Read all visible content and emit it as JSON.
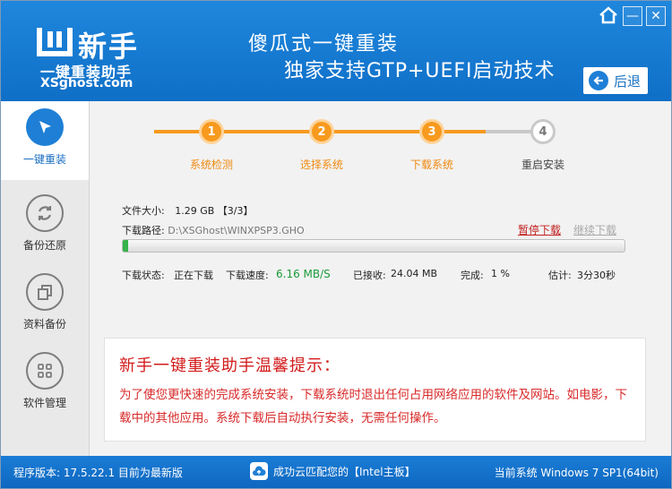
{
  "header": {
    "logo_cn": "新手",
    "logo_sub": "一键重装助手",
    "logo_site": "XSghost.com",
    "slogan_line1": "傻瓜式一键重装",
    "slogan_line2": "独家支持GTP+UEFI启动技术",
    "back_label": "后退",
    "controls": [
      "home-icon",
      "minimize-icon",
      "close-icon"
    ]
  },
  "sidebar": {
    "items": [
      {
        "label": "一键重装",
        "icon": "cursor-arrow-icon",
        "active": true
      },
      {
        "label": "备份还原",
        "icon": "sync-icon",
        "active": false
      },
      {
        "label": "资料备份",
        "icon": "copy-icon",
        "active": false
      },
      {
        "label": "软件管理",
        "icon": "grid-icon",
        "active": false
      }
    ]
  },
  "steps": [
    {
      "num": "1",
      "label": "系统检测",
      "done": true
    },
    {
      "num": "2",
      "label": "选择系统",
      "done": true
    },
    {
      "num": "3",
      "label": "下载系统",
      "done": true
    },
    {
      "num": "4",
      "label": "重启安装",
      "done": false
    }
  ],
  "download": {
    "file_size_label": "文件大小:",
    "file_size_value": "1.29 GB 【3/3】",
    "path_label": "下载路径:",
    "path_value": "D:\\XSGhost\\WINXPSP3.GHO",
    "pause_label": "暂停下载",
    "resume_label": "继续下载",
    "progress_percent": 1,
    "status_label": "下载状态:",
    "status_value": "正在下载",
    "speed_label": "下载速度:",
    "speed_value": "6.16 MB/S",
    "received_label": "已接收:",
    "received_value": "24.04 MB",
    "complete_label": "完成:",
    "complete_value": "1 %",
    "eta_label": "估计:",
    "eta_value": "3分30秒"
  },
  "tip": {
    "title": "新手一键重装助手温馨提示：",
    "body": "为了使您更快速的完成系统安装，下载系统时退出任何占用网络应用的软件及网站。如电影，下载中的其他应用。系统下载后自动执行安装，无需任何操作。"
  },
  "footer": {
    "version": "程序版本: 17.5.22.1 目前为最新版",
    "cloud_text": "成功云匹配您的【Intel主板】",
    "current_system": "当前系统 Windows 7 SP1(64bit)"
  },
  "colors": {
    "brand_blue": "#1f87dd",
    "step_orange": "#f79a1e",
    "alert_red": "#d21b1b",
    "progress_green": "#36b34a"
  }
}
